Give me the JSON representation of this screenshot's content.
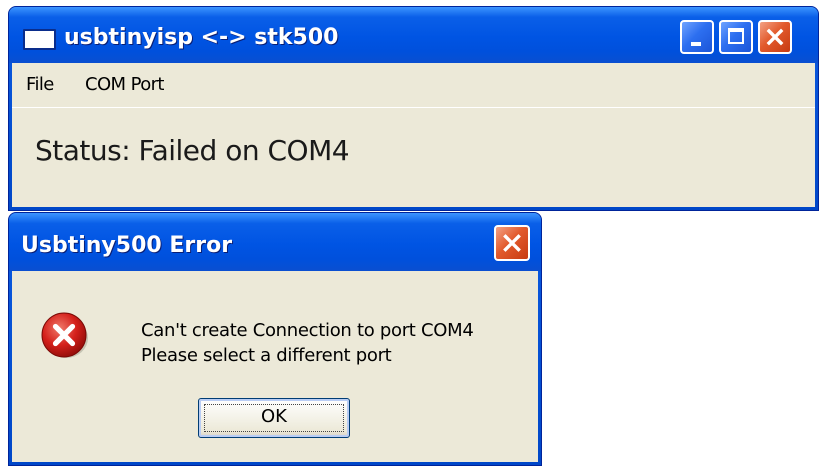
{
  "main_window": {
    "title": "usbtinyisp <-> stk500",
    "menu": {
      "items": [
        {
          "label": "File"
        },
        {
          "label": "COM Port"
        }
      ]
    },
    "status": "Status: Failed on COM4",
    "icons": {
      "app": "window-icon",
      "minimize": "minimize-icon",
      "maximize": "maximize-icon",
      "close": "close-icon"
    }
  },
  "error_dialog": {
    "title": "Usbtiny500 Error",
    "message_lines": [
      "Can't create Connection to port COM4",
      "Please select a different port"
    ],
    "ok_label": "OK",
    "icons": {
      "error": "error-icon",
      "close": "close-icon"
    }
  },
  "colors": {
    "titlebar_blue": "#0054e3",
    "client_background": "#ece9d8",
    "close_button_red": "#e25a2c",
    "error_icon_red": "#d4201b"
  }
}
